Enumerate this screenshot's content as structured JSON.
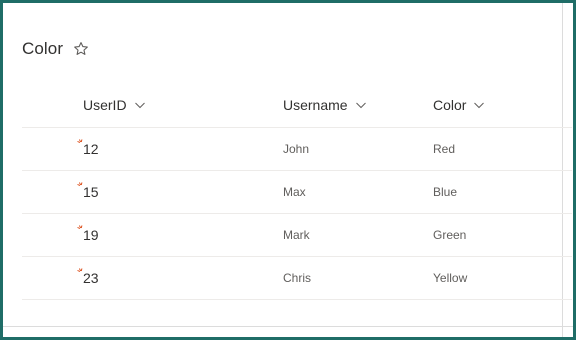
{
  "list": {
    "title": "Color"
  },
  "columns": [
    {
      "label": "UserID"
    },
    {
      "label": "Username"
    },
    {
      "label": "Color"
    }
  ],
  "rows": [
    {
      "user_id": "12",
      "username": "John",
      "color": "Red"
    },
    {
      "user_id": "15",
      "username": "Max",
      "color": "Blue"
    },
    {
      "user_id": "19",
      "username": "Mark",
      "color": "Green"
    },
    {
      "user_id": "23",
      "username": "Chris",
      "color": "Yellow"
    }
  ],
  "colors": {
    "frame_border": "#1f6d67",
    "new_item_indicator": "#d83b01"
  }
}
